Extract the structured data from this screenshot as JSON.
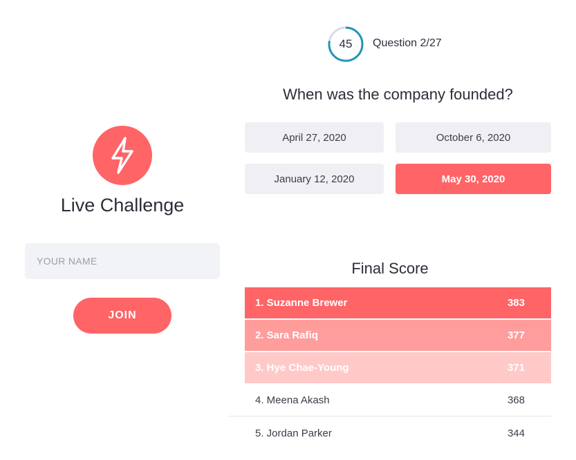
{
  "colors": {
    "accent": "#ff6466",
    "accent_mid": "#ff9d9c",
    "accent_light": "#ffc9c8",
    "input_bg": "#f2f3f6",
    "answer_bg": "#f0f0f4",
    "timer_ring": "#2395b4"
  },
  "join_panel": {
    "logo_icon": "lightning-bolt-icon",
    "title": "Live Challenge",
    "name_placeholder": "YOUR NAME",
    "join_label": "JOIN"
  },
  "quiz": {
    "timer_seconds": "45",
    "timer_progress": 0.78,
    "question_counter": "Question 2/27",
    "question": "When was the company founded?",
    "answers": [
      {
        "label": "April 27, 2020",
        "selected": false
      },
      {
        "label": "October 6, 2020",
        "selected": false
      },
      {
        "label": "January 12, 2020",
        "selected": false
      },
      {
        "label": "May 30, 2020",
        "selected": true
      }
    ]
  },
  "final_score": {
    "title": "Final Score",
    "rows": [
      {
        "name": "1. Suzanne Brewer",
        "score": "383"
      },
      {
        "name": "2. Sara Rafiq",
        "score": "377"
      },
      {
        "name": "3. Hye Chae-Young",
        "score": "371"
      },
      {
        "name": "4. Meena Akash",
        "score": "368"
      },
      {
        "name": "5. Jordan Parker",
        "score": "344"
      }
    ]
  }
}
